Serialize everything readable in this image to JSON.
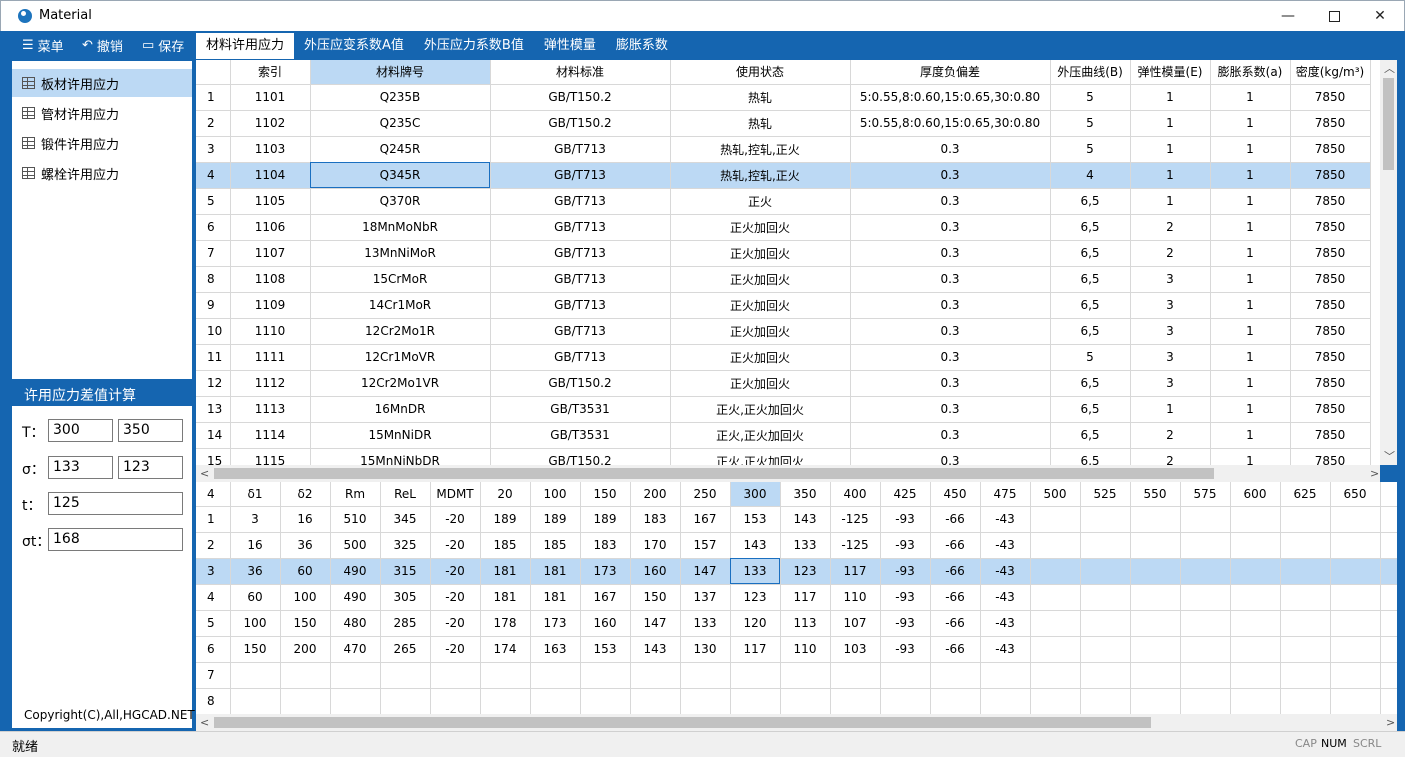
{
  "window": {
    "title": "Material"
  },
  "toolbar": {
    "menu": "菜单",
    "undo": "撤销",
    "save": "保存"
  },
  "nav": {
    "items": [
      "板材许用应力",
      "管材许用应力",
      "锻件许用应力",
      "螺栓许用应力"
    ],
    "selected_index": 0
  },
  "calc": {
    "title": "许用应力差值计算",
    "t_label": "T：",
    "t1": "300",
    "t2": "350",
    "sigma_label": "σ：",
    "sigma1": "133",
    "sigma2": "123",
    "tt_label": "t：",
    "tt": "125",
    "sigma_t_label": "σt：",
    "sigma_t": "168"
  },
  "copyright": "Copyright(C),All,HGCAD.NET",
  "tabs": [
    "材料许用应力",
    "外压应变系数A值",
    "外压应力系数B值",
    "弹性模量",
    "膨胀系数"
  ],
  "upper_table": {
    "headers": [
      "",
      "索引",
      "材料牌号",
      "材料标准",
      "使用状态",
      "厚度负偏差",
      "外压曲线(B)",
      "弹性模量(E)",
      "膨胀系数(a)",
      "密度(kg/m³)"
    ],
    "rows": [
      [
        "1",
        "1101",
        "Q235B",
        "GB/T150.2",
        "热轧",
        "5:0.55,8:0.60,15:0.65,30:0.80",
        "5",
        "1",
        "1",
        "7850"
      ],
      [
        "2",
        "1102",
        "Q235C",
        "GB/T150.2",
        "热轧",
        "5:0.55,8:0.60,15:0.65,30:0.80",
        "5",
        "1",
        "1",
        "7850"
      ],
      [
        "3",
        "1103",
        "Q245R",
        "GB/T713",
        "热轧,控轧,正火",
        "0.3",
        "5",
        "1",
        "1",
        "7850"
      ],
      [
        "4",
        "1104",
        "Q345R",
        "GB/T713",
        "热轧,控轧,正火",
        "0.3",
        "4",
        "1",
        "1",
        "7850"
      ],
      [
        "5",
        "1105",
        "Q370R",
        "GB/T713",
        "正火",
        "0.3",
        "6,5",
        "1",
        "1",
        "7850"
      ],
      [
        "6",
        "1106",
        "18MnMoNbR",
        "GB/T713",
        "正火加回火",
        "0.3",
        "6,5",
        "2",
        "1",
        "7850"
      ],
      [
        "7",
        "1107",
        "13MnNiMoR",
        "GB/T713",
        "正火加回火",
        "0.3",
        "6,5",
        "2",
        "1",
        "7850"
      ],
      [
        "8",
        "1108",
        "15CrMoR",
        "GB/T713",
        "正火加回火",
        "0.3",
        "6,5",
        "3",
        "1",
        "7850"
      ],
      [
        "9",
        "1109",
        "14Cr1MoR",
        "GB/T713",
        "正火加回火",
        "0.3",
        "6,5",
        "3",
        "1",
        "7850"
      ],
      [
        "10",
        "1110",
        "12Cr2Mo1R",
        "GB/T713",
        "正火加回火",
        "0.3",
        "6,5",
        "3",
        "1",
        "7850"
      ],
      [
        "11",
        "1111",
        "12Cr1MoVR",
        "GB/T713",
        "正火加回火",
        "0.3",
        "5",
        "3",
        "1",
        "7850"
      ],
      [
        "12",
        "1112",
        "12Cr2Mo1VR",
        "GB/T150.2",
        "正火加回火",
        "0.3",
        "6,5",
        "3",
        "1",
        "7850"
      ],
      [
        "13",
        "1113",
        "16MnDR",
        "GB/T3531",
        "正火,正火加回火",
        "0.3",
        "6,5",
        "1",
        "1",
        "7850"
      ],
      [
        "14",
        "1114",
        "15MnNiDR",
        "GB/T3531",
        "正火,正火加回火",
        "0.3",
        "6,5",
        "2",
        "1",
        "7850"
      ],
      [
        "15",
        "1115",
        "15MnNiNbDR",
        "GB/T150.2",
        "正火,正火加回火",
        "0.3",
        "6,5",
        "2",
        "1",
        "7850"
      ]
    ],
    "selected_row": 3
  },
  "lower_table": {
    "headers": [
      "4",
      "δ1",
      "δ2",
      "Rm",
      "ReL",
      "MDMT",
      "20",
      "100",
      "150",
      "200",
      "250",
      "300",
      "350",
      "400",
      "425",
      "450",
      "475",
      "500",
      "525",
      "550",
      "575",
      "600",
      "625",
      "650",
      ""
    ],
    "rows": [
      [
        "1",
        "3",
        "16",
        "510",
        "345",
        "-20",
        "189",
        "189",
        "189",
        "183",
        "167",
        "153",
        "143",
        "-125",
        "-93",
        "-66",
        "-43",
        "",
        "",
        "",
        "",
        "",
        "",
        "",
        ""
      ],
      [
        "2",
        "16",
        "36",
        "500",
        "325",
        "-20",
        "185",
        "185",
        "183",
        "170",
        "157",
        "143",
        "133",
        "-125",
        "-93",
        "-66",
        "-43",
        "",
        "",
        "",
        "",
        "",
        "",
        "",
        ""
      ],
      [
        "3",
        "36",
        "60",
        "490",
        "315",
        "-20",
        "181",
        "181",
        "173",
        "160",
        "147",
        "133",
        "123",
        "117",
        "-93",
        "-66",
        "-43",
        "",
        "",
        "",
        "",
        "",
        "",
        "",
        ""
      ],
      [
        "4",
        "60",
        "100",
        "490",
        "305",
        "-20",
        "181",
        "181",
        "167",
        "150",
        "137",
        "123",
        "117",
        "110",
        "-93",
        "-66",
        "-43",
        "",
        "",
        "",
        "",
        "",
        "",
        "",
        ""
      ],
      [
        "5",
        "100",
        "150",
        "480",
        "285",
        "-20",
        "178",
        "173",
        "160",
        "147",
        "133",
        "120",
        "113",
        "107",
        "-93",
        "-66",
        "-43",
        "",
        "",
        "",
        "",
        "",
        "",
        "",
        ""
      ],
      [
        "6",
        "150",
        "200",
        "470",
        "265",
        "-20",
        "174",
        "163",
        "153",
        "143",
        "130",
        "117",
        "110",
        "103",
        "-93",
        "-66",
        "-43",
        "",
        "",
        "",
        "",
        "",
        "",
        "",
        ""
      ],
      [
        "7",
        "",
        "",
        "",
        "",
        "",
        "",
        "",
        "",
        "",
        "",
        "",
        "",
        "",
        "",
        "",
        "",
        "",
        "",
        "",
        "",
        "",
        "",
        "",
        ""
      ],
      [
        "8",
        "",
        "",
        "",
        "",
        "",
        "",
        "",
        "",
        "",
        "",
        "",
        "",
        "",
        "",
        "",
        "",
        "",
        "",
        "",
        "",
        "",
        "",
        "",
        ""
      ]
    ],
    "selected_row": 2,
    "selected_col": 11
  },
  "status": {
    "text": "就绪",
    "cap": "CAP",
    "num": "NUM",
    "scrl": "SCRL"
  }
}
